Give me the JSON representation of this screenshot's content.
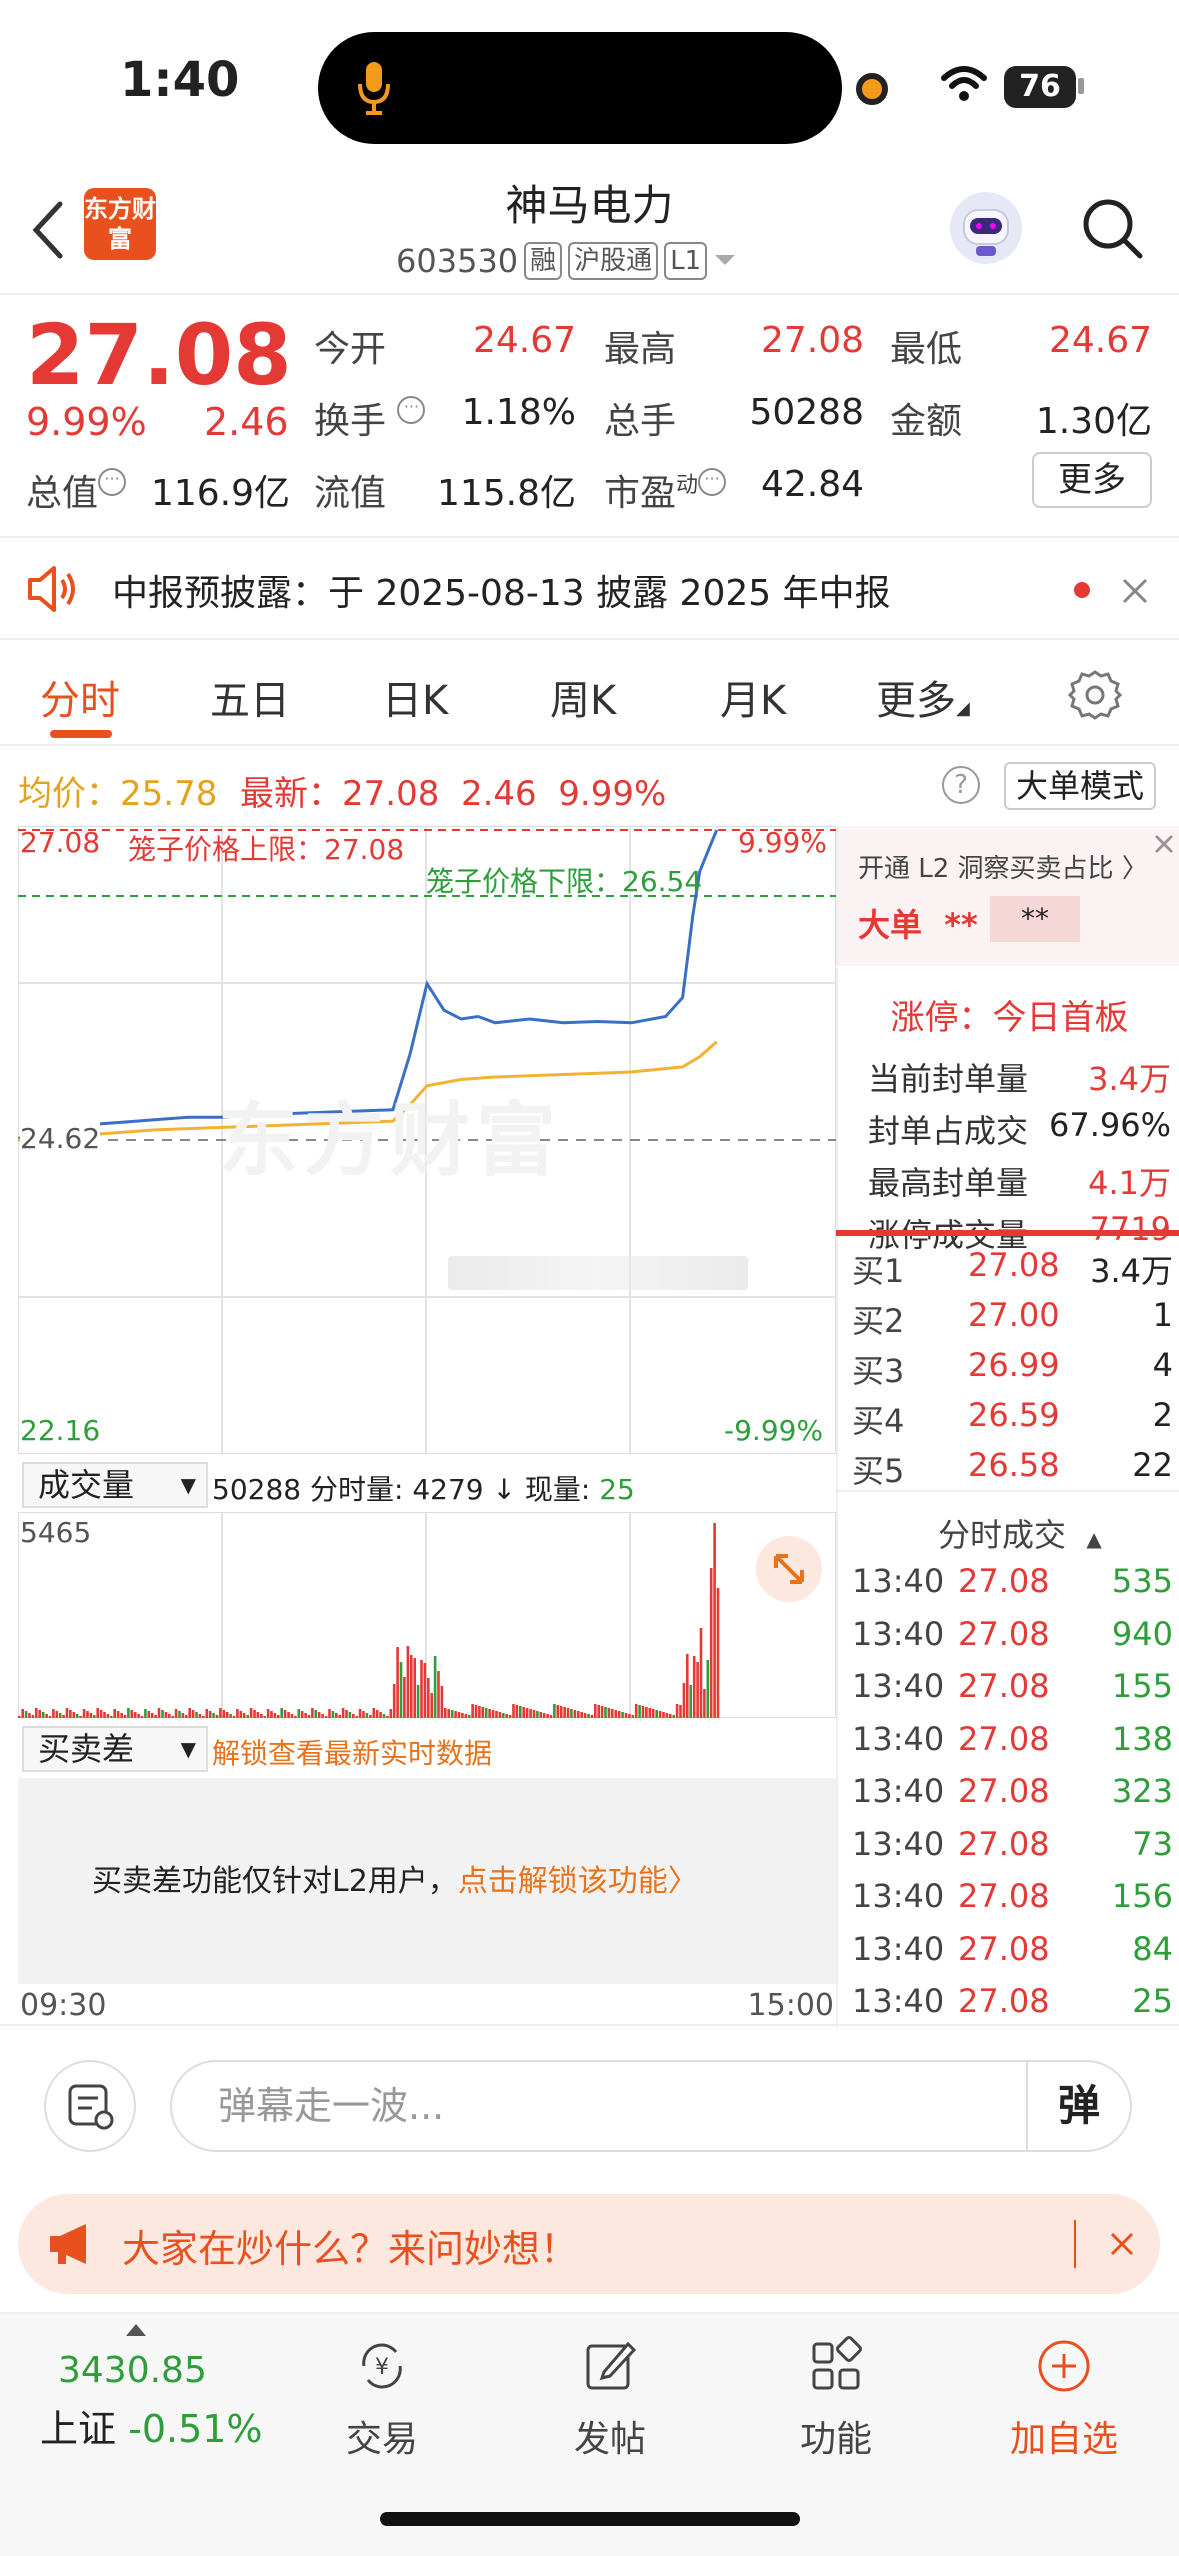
{
  "status": {
    "time": "1:40",
    "battery": "76"
  },
  "nav": {
    "logo_text": "东方财富",
    "stock_name": "神马电力",
    "stock_code": "603530",
    "tags": [
      "融",
      "沪股通",
      "L1"
    ]
  },
  "quote": {
    "price": "27.08",
    "pct": "9.99%",
    "change": "2.46",
    "labels": {
      "open": "今开",
      "high": "最高",
      "low": "最低",
      "turnover": "换手",
      "volume": "总手",
      "amount": "金额",
      "mktcap": "总值",
      "float": "流值",
      "pe": "市盈",
      "pe_sup": "动"
    },
    "values": {
      "open": "24.67",
      "high": "27.08",
      "low": "24.67",
      "turnover": "1.18%",
      "volume": "50288",
      "amount": "1.30亿",
      "mktcap": "116.9亿",
      "float": "115.8亿",
      "pe": "42.84"
    },
    "more": "更多"
  },
  "notice": {
    "text": "中报预披露：于 2025-08-13 披露 2025 年中报"
  },
  "tabs": [
    "分时",
    "五日",
    "日K",
    "周K",
    "月K",
    "更多"
  ],
  "chart_header": {
    "avg_label": "均价：",
    "avg_value": "25.78",
    "latest_label": "最新：",
    "latest_price": "27.08",
    "latest_change": "2.46",
    "latest_pct": "9.99%",
    "mode_button": "大单模式"
  },
  "chart": {
    "top_price": "27.08",
    "top_pct": "9.99%",
    "cage_upper": "笼子价格上限：27.08",
    "cage_lower": "笼子价格下限：26.54",
    "prev_close": "24.62",
    "bottom_price": "22.16",
    "bottom_pct": "-9.99%",
    "watermark": "东方财富",
    "colors": {
      "price_line": "#3a6fc7",
      "avg_line": "#f2b233",
      "up": "#e53935",
      "down": "#2e9e3a"
    }
  },
  "chart_data": {
    "type": "line",
    "title": "",
    "ylim": [
      22.16,
      27.08
    ],
    "prev_close": 24.62,
    "series": [
      {
        "name": "",
        "x": [
          0,
          10,
          20,
          30,
          40,
          50,
          60,
          70,
          80,
          90,
          100,
          110,
          115,
          120,
          125,
          130,
          135,
          140,
          150,
          160,
          170,
          180,
          190,
          195,
          198,
          200,
          203,
          205
        ],
        "values": [
          24.63,
          24.7,
          24.74,
          24.76,
          24.78,
          24.8,
          24.8,
          24.82,
          24.83,
          24.84,
          24.85,
          24.86,
          25.3,
          25.86,
          25.65,
          25.58,
          25.6,
          25.55,
          25.58,
          25.55,
          25.56,
          25.55,
          25.6,
          25.75,
          26.4,
          26.75,
          26.95,
          27.08
        ]
      },
      {
        "name": "",
        "x": [
          0,
          20,
          40,
          60,
          80,
          100,
          110,
          115,
          120,
          130,
          140,
          160,
          180,
          195,
          200,
          205
        ],
        "values": [
          24.62,
          24.66,
          24.7,
          24.72,
          24.74,
          24.76,
          24.77,
          24.9,
          25.05,
          25.1,
          25.12,
          25.14,
          25.16,
          25.2,
          25.28,
          25.4
        ]
      }
    ]
  },
  "volume": {
    "selector": "成交量",
    "total": "50288",
    "minute_label": "分时量:",
    "minute_value": "4279",
    "current_label": "现量:",
    "current_value": "25",
    "max_label": "5465"
  },
  "diff": {
    "selector": "买卖差",
    "unlock_hint": "解锁查看最新实时数据",
    "panel_text": "买卖差功能仅针对L2用户，",
    "panel_link": "点击解锁该功能"
  },
  "time_axis": {
    "start": "09:30",
    "end": "15:00"
  },
  "right_panel": {
    "l2_title": "开通 L2 洞察买卖占比",
    "big_order_label": "大单",
    "big_order_value": "**",
    "big_order_box": "**",
    "limit_title": "涨停：今日首板",
    "stats": [
      {
        "label": "当前封单量",
        "value": "3.4万"
      },
      {
        "label": "封单占成交",
        "value": "67.96%"
      },
      {
        "label": "最高封单量",
        "value": "4.1万"
      },
      {
        "label": "涨停成交量",
        "value": "7719"
      }
    ],
    "bids": [
      {
        "label": "买1",
        "price": "27.08",
        "vol": "3.4万"
      },
      {
        "label": "买2",
        "price": "27.00",
        "vol": "1"
      },
      {
        "label": "买3",
        "price": "26.99",
        "vol": "4"
      },
      {
        "label": "买4",
        "price": "26.59",
        "vol": "2"
      },
      {
        "label": "买5",
        "price": "26.58",
        "vol": "22"
      }
    ],
    "trades_title": "分时成交",
    "trades": [
      {
        "time": "13:40",
        "price": "27.08",
        "vol": "535"
      },
      {
        "time": "13:40",
        "price": "27.08",
        "vol": "940"
      },
      {
        "time": "13:40",
        "price": "27.08",
        "vol": "155"
      },
      {
        "time": "13:40",
        "price": "27.08",
        "vol": "138"
      },
      {
        "time": "13:40",
        "price": "27.08",
        "vol": "323"
      },
      {
        "time": "13:40",
        "price": "27.08",
        "vol": "73"
      },
      {
        "time": "13:40",
        "price": "27.08",
        "vol": "156"
      },
      {
        "time": "13:40",
        "price": "27.08",
        "vol": "84"
      },
      {
        "time": "13:40",
        "price": "27.08",
        "vol": "25"
      }
    ]
  },
  "comment": {
    "placeholder": "弹幕走一波...",
    "danmu_button": "弹"
  },
  "banner": {
    "text": "大家在炒什么？来问妙想！"
  },
  "bottom_nav": {
    "index_value": "3430.85",
    "index_name": "上证",
    "index_pct": "-0.51%",
    "items": [
      "交易",
      "发帖",
      "功能",
      "加自选"
    ]
  }
}
